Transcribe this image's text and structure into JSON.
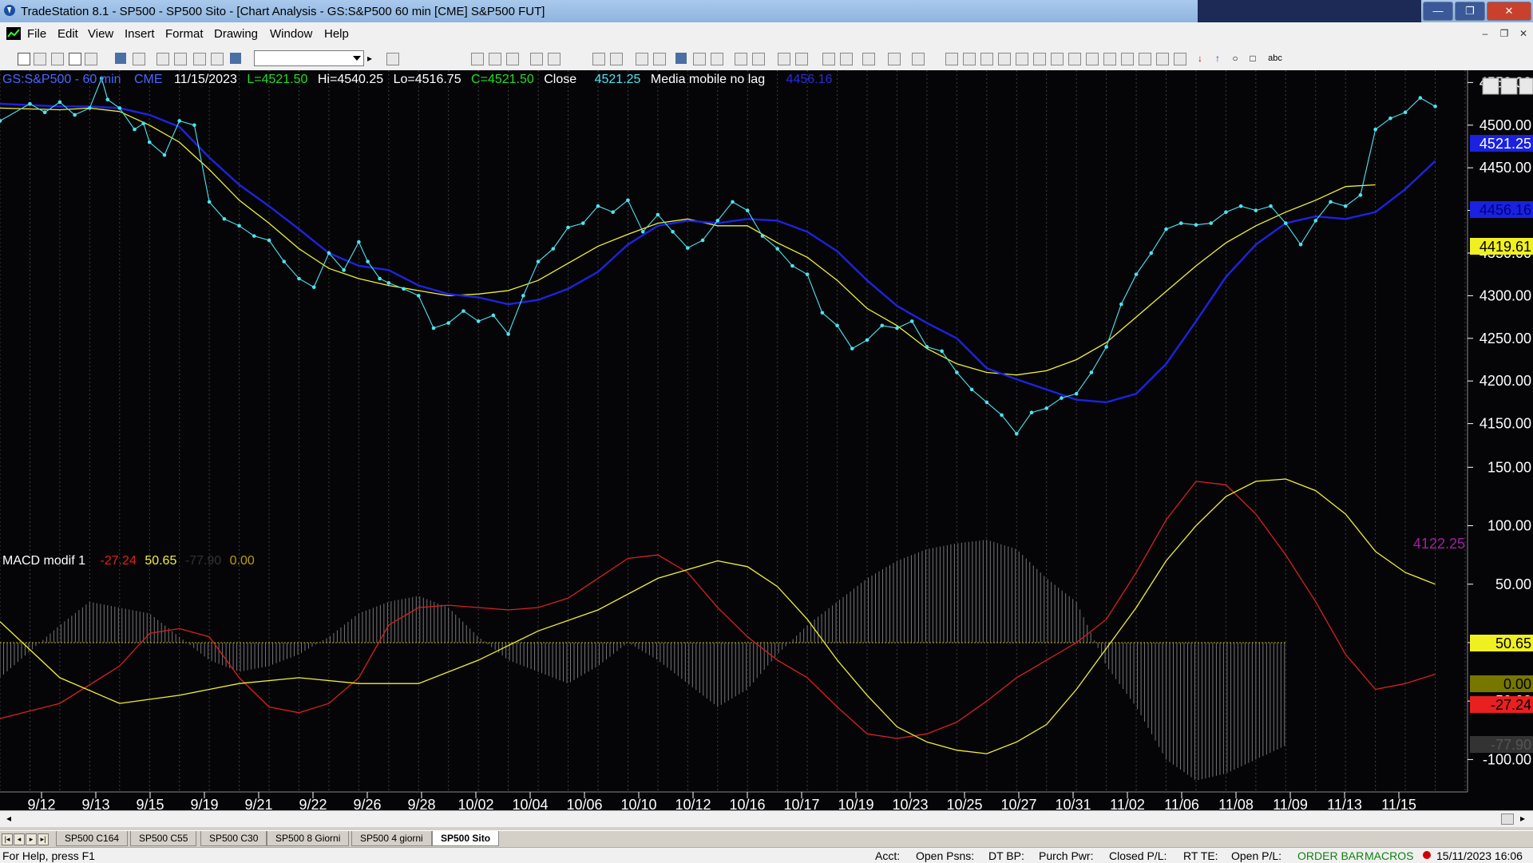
{
  "window": {
    "title": "TradeStation 8.1 - SP500 - SP500 Sito - [Chart Analysis - GS:S&P500  60 min  [CME] S&P500 FUT]",
    "controls": {
      "minimize": "—",
      "maximize": "❐",
      "close": "✕"
    }
  },
  "menu": {
    "items": [
      "File",
      "Edit",
      "View",
      "Insert",
      "Format",
      "Drawing",
      "Window",
      "Help"
    ]
  },
  "mdi_controls": {
    "minimize": "–",
    "restore": "❐",
    "close": "✕"
  },
  "chart_header": {
    "symbol": "GS:S&P500 - 60 min",
    "exchange": "CME",
    "date": "11/15/2023",
    "last": "L=4521.50",
    "high": "Hi=4540.25",
    "low": "Lo=4516.75",
    "close_val": "C=4521.50",
    "close_label": "Close",
    "close_value": "4521.25",
    "ma_label": "Media mobile no lag",
    "ma_value": "4456.16"
  },
  "macd_header": {
    "label": "MACD modif 1",
    "v1": "-27.24",
    "v2": "50.65",
    "v3": "-77.90",
    "v4": "0.00"
  },
  "colors": {
    "price": "#4fe4ef",
    "ma_blue": "#1e22e0",
    "ma_yellow": "#f0f032",
    "macd_red": "#d82020",
    "histogram": "#8a8a8a",
    "background": "#050508",
    "grid": "#555555",
    "axis_text": "#ffffff"
  },
  "chart_data": {
    "type": "line",
    "x_labels": [
      "9/12",
      "9/13",
      "9/15",
      "9/19",
      "9/21",
      "9/22",
      "9/26",
      "9/28",
      "10/02",
      "10/04",
      "10/06",
      "10/10",
      "10/12",
      "10/16",
      "10/17",
      "10/19",
      "10/23",
      "10/25",
      "10/27",
      "10/31",
      "11/02",
      "11/06",
      "11/08",
      "11/09",
      "11/13",
      "11/15"
    ],
    "price_panel": {
      "ylim": [
        4115,
        4555
      ],
      "y_ticks": [
        "4550.00",
        "4500.00",
        "4450.00",
        "4400.00",
        "4350.00",
        "4300.00",
        "4250.00",
        "4200.00",
        "4150.00"
      ],
      "price_anchors": [
        [
          0,
          4505
        ],
        [
          1,
          4525
        ],
        [
          1.5,
          4515
        ],
        [
          2,
          4527
        ],
        [
          2.5,
          4512
        ],
        [
          3,
          4520
        ],
        [
          3.4,
          4555
        ],
        [
          3.6,
          4530
        ],
        [
          4,
          4520
        ],
        [
          4.5,
          4495
        ],
        [
          4.8,
          4502
        ],
        [
          5,
          4480
        ],
        [
          5.5,
          4465
        ],
        [
          6,
          4505
        ],
        [
          6.5,
          4500
        ],
        [
          7,
          4410
        ],
        [
          7.5,
          4390
        ],
        [
          8,
          4382
        ],
        [
          8.5,
          4370
        ],
        [
          9,
          4365
        ],
        [
          9.5,
          4340
        ],
        [
          10,
          4320
        ],
        [
          10.5,
          4310
        ],
        [
          11,
          4350
        ],
        [
          11.5,
          4330
        ],
        [
          12,
          4363
        ],
        [
          12.3,
          4340
        ],
        [
          12.7,
          4320
        ],
        [
          13,
          4315
        ],
        [
          13.5,
          4308
        ],
        [
          14,
          4300
        ],
        [
          14.5,
          4262
        ],
        [
          15,
          4268
        ],
        [
          15.5,
          4282
        ],
        [
          16,
          4270
        ],
        [
          16.5,
          4277
        ],
        [
          17,
          4255
        ],
        [
          17.5,
          4300
        ],
        [
          18,
          4340
        ],
        [
          18.5,
          4355
        ],
        [
          19,
          4380
        ],
        [
          19.5,
          4385
        ],
        [
          20,
          4405
        ],
        [
          20.5,
          4398
        ],
        [
          21,
          4412
        ],
        [
          21.5,
          4375
        ],
        [
          22,
          4395
        ],
        [
          22.5,
          4375
        ],
        [
          23,
          4356
        ],
        [
          23.5,
          4365
        ],
        [
          24,
          4388
        ],
        [
          24.5,
          4410
        ],
        [
          25,
          4400
        ],
        [
          25.5,
          4370
        ],
        [
          26,
          4355
        ],
        [
          26.5,
          4335
        ],
        [
          27,
          4325
        ],
        [
          27.5,
          4280
        ],
        [
          28,
          4265
        ],
        [
          28.5,
          4238
        ],
        [
          29,
          4248
        ],
        [
          29.5,
          4265
        ],
        [
          30,
          4262
        ],
        [
          30.5,
          4270
        ],
        [
          31,
          4240
        ],
        [
          31.5,
          4235
        ],
        [
          32,
          4210
        ],
        [
          32.5,
          4190
        ],
        [
          33,
          4175
        ],
        [
          33.5,
          4160
        ],
        [
          34,
          4138
        ],
        [
          34.5,
          4163
        ],
        [
          35,
          4168
        ],
        [
          35.5,
          4180
        ],
        [
          36,
          4185
        ],
        [
          36.5,
          4210
        ],
        [
          37,
          4240
        ],
        [
          37.5,
          4290
        ],
        [
          38,
          4325
        ],
        [
          38.5,
          4350
        ],
        [
          39,
          4378
        ],
        [
          39.5,
          4385
        ],
        [
          40,
          4383
        ],
        [
          40.5,
          4385
        ],
        [
          41,
          4398
        ],
        [
          41.5,
          4405
        ],
        [
          42,
          4400
        ],
        [
          42.5,
          4405
        ],
        [
          43,
          4385
        ],
        [
          43.5,
          4360
        ],
        [
          44,
          4388
        ],
        [
          44.5,
          4410
        ],
        [
          45,
          4405
        ],
        [
          45.5,
          4418
        ],
        [
          46,
          4495
        ],
        [
          46.5,
          4508
        ],
        [
          47,
          4515
        ],
        [
          47.5,
          4532
        ],
        [
          48,
          4522
        ]
      ],
      "ma_blue_anchors": [
        [
          0,
          4525
        ],
        [
          2,
          4522
        ],
        [
          3,
          4522
        ],
        [
          4,
          4520
        ],
        [
          5,
          4512
        ],
        [
          6,
          4498
        ],
        [
          7,
          4462
        ],
        [
          8,
          4430
        ],
        [
          9,
          4405
        ],
        [
          10,
          4378
        ],
        [
          11,
          4350
        ],
        [
          12,
          4335
        ],
        [
          13,
          4330
        ],
        [
          14,
          4312
        ],
        [
          15,
          4302
        ],
        [
          16,
          4298
        ],
        [
          17,
          4290
        ],
        [
          18,
          4295
        ],
        [
          19,
          4308
        ],
        [
          20,
          4328
        ],
        [
          21,
          4360
        ],
        [
          22,
          4382
        ],
        [
          23,
          4388
        ],
        [
          24,
          4385
        ],
        [
          25,
          4390
        ],
        [
          26,
          4388
        ],
        [
          27,
          4375
        ],
        [
          28,
          4352
        ],
        [
          29,
          4318
        ],
        [
          30,
          4288
        ],
        [
          31,
          4268
        ],
        [
          32,
          4250
        ],
        [
          33,
          4215
        ],
        [
          34,
          4202
        ],
        [
          35,
          4190
        ],
        [
          36,
          4178
        ],
        [
          37,
          4175
        ],
        [
          38,
          4185
        ],
        [
          39,
          4220
        ],
        [
          40,
          4270
        ],
        [
          41,
          4322
        ],
        [
          42,
          4360
        ],
        [
          43,
          4385
        ],
        [
          44,
          4393
        ],
        [
          45,
          4390
        ],
        [
          46,
          4398
        ],
        [
          47,
          4425
        ],
        [
          48,
          4458
        ]
      ],
      "ma_yellow_anchors": [
        [
          0,
          4520
        ],
        [
          2,
          4518
        ],
        [
          3,
          4520
        ],
        [
          4,
          4516
        ],
        [
          5,
          4500
        ],
        [
          6,
          4480
        ],
        [
          7,
          4448
        ],
        [
          8,
          4412
        ],
        [
          9,
          4385
        ],
        [
          10,
          4355
        ],
        [
          11,
          4332
        ],
        [
          12,
          4320
        ],
        [
          13,
          4312
        ],
        [
          14,
          4306
        ],
        [
          15,
          4300
        ],
        [
          16,
          4302
        ],
        [
          17,
          4306
        ],
        [
          18,
          4318
        ],
        [
          19,
          4338
        ],
        [
          20,
          4358
        ],
        [
          21,
          4372
        ],
        [
          22,
          4385
        ],
        [
          23,
          4390
        ],
        [
          24,
          4382
        ],
        [
          25,
          4382
        ],
        [
          26,
          4362
        ],
        [
          27,
          4345
        ],
        [
          28,
          4318
        ],
        [
          29,
          4285
        ],
        [
          30,
          4265
        ],
        [
          31,
          4238
        ],
        [
          32,
          4220
        ],
        [
          33,
          4210
        ],
        [
          34,
          4207
        ],
        [
          35,
          4212
        ],
        [
          36,
          4225
        ],
        [
          37,
          4245
        ],
        [
          38,
          4275
        ],
        [
          39,
          4305
        ],
        [
          40,
          4335
        ],
        [
          41,
          4362
        ],
        [
          42,
          4382
        ],
        [
          43,
          4398
        ],
        [
          44,
          4412
        ],
        [
          45,
          4428
        ],
        [
          46,
          4430
        ]
      ]
    },
    "macd_panel": {
      "ylim": [
        -125,
        155
      ],
      "y_ticks": [
        "150.00",
        "100.00",
        "50.00",
        "0.00",
        "-50.00",
        "-100.00"
      ],
      "red_anchors": [
        [
          0,
          -65
        ],
        [
          2,
          -52
        ],
        [
          4,
          -20
        ],
        [
          5,
          8
        ],
        [
          6,
          12
        ],
        [
          7,
          5
        ],
        [
          8,
          -30
        ],
        [
          9,
          -55
        ],
        [
          10,
          -60
        ],
        [
          11,
          -52
        ],
        [
          12,
          -30
        ],
        [
          13,
          15
        ],
        [
          14,
          30
        ],
        [
          15,
          32
        ],
        [
          16,
          30
        ],
        [
          17,
          28
        ],
        [
          18,
          30
        ],
        [
          19,
          38
        ],
        [
          20,
          55
        ],
        [
          21,
          72
        ],
        [
          22,
          75
        ],
        [
          23,
          60
        ],
        [
          24,
          30
        ],
        [
          25,
          5
        ],
        [
          26,
          -15
        ],
        [
          27,
          -30
        ],
        [
          28,
          -55
        ],
        [
          29,
          -78
        ],
        [
          30,
          -82
        ],
        [
          31,
          -78
        ],
        [
          32,
          -68
        ],
        [
          33,
          -50
        ],
        [
          34,
          -30
        ],
        [
          35,
          -15
        ],
        [
          36,
          0
        ],
        [
          37,
          20
        ],
        [
          38,
          60
        ],
        [
          39,
          105
        ],
        [
          40,
          138
        ],
        [
          41,
          135
        ],
        [
          42,
          110
        ],
        [
          43,
          75
        ],
        [
          44,
          35
        ],
        [
          45,
          -10
        ],
        [
          46,
          -40
        ],
        [
          47,
          -35
        ],
        [
          48,
          -27
        ]
      ],
      "yellow_anchors": [
        [
          0,
          18
        ],
        [
          2,
          -30
        ],
        [
          4,
          -52
        ],
        [
          6,
          -45
        ],
        [
          8,
          -35
        ],
        [
          10,
          -30
        ],
        [
          12,
          -35
        ],
        [
          14,
          -35
        ],
        [
          16,
          -15
        ],
        [
          18,
          10
        ],
        [
          20,
          28
        ],
        [
          22,
          55
        ],
        [
          24,
          70
        ],
        [
          25,
          65
        ],
        [
          26,
          48
        ],
        [
          27,
          20
        ],
        [
          28,
          -15
        ],
        [
          29,
          -45
        ],
        [
          30,
          -72
        ],
        [
          31,
          -85
        ],
        [
          32,
          -92
        ],
        [
          33,
          -95
        ],
        [
          34,
          -85
        ],
        [
          35,
          -70
        ],
        [
          36,
          -40
        ],
        [
          37,
          -5
        ],
        [
          38,
          30
        ],
        [
          39,
          70
        ],
        [
          40,
          100
        ],
        [
          41,
          125
        ],
        [
          42,
          138
        ],
        [
          43,
          140
        ],
        [
          44,
          130
        ],
        [
          45,
          110
        ],
        [
          46,
          78
        ],
        [
          47,
          60
        ],
        [
          48,
          50
        ]
      ],
      "histogram_anchors": [
        [
          0,
          -30
        ],
        [
          2,
          15
        ],
        [
          3,
          35
        ],
        [
          4,
          30
        ],
        [
          5,
          25
        ],
        [
          6,
          5
        ],
        [
          7,
          -15
        ],
        [
          8,
          -25
        ],
        [
          9,
          -20
        ],
        [
          10,
          -10
        ],
        [
          11,
          5
        ],
        [
          12,
          25
        ],
        [
          13,
          35
        ],
        [
          14,
          40
        ],
        [
          15,
          30
        ],
        [
          16,
          5
        ],
        [
          17,
          -15
        ],
        [
          18,
          -25
        ],
        [
          19,
          -35
        ],
        [
          20,
          -20
        ],
        [
          21,
          0
        ],
        [
          22,
          -15
        ],
        [
          23,
          -35
        ],
        [
          24,
          -55
        ],
        [
          25,
          -40
        ],
        [
          26,
          -10
        ],
        [
          27,
          15
        ],
        [
          28,
          35
        ],
        [
          29,
          55
        ],
        [
          30,
          70
        ],
        [
          31,
          80
        ],
        [
          32,
          85
        ],
        [
          33,
          88
        ],
        [
          34,
          80
        ],
        [
          35,
          55
        ],
        [
          36,
          35
        ],
        [
          37,
          -20
        ],
        [
          38,
          -55
        ],
        [
          39,
          -100
        ],
        [
          40,
          -118
        ],
        [
          41,
          -112
        ],
        [
          42,
          -100
        ],
        [
          43,
          -88
        ]
      ]
    },
    "floating_value": "4122.25",
    "axis_labels": {
      "price_blue": "4456.16",
      "price_yellow": "4419.61",
      "price_close": "4521.25",
      "macd_yellow": "50.65",
      "macd_zero": "0.00",
      "macd_red": "-27.24",
      "macd_gray": "-77.90"
    }
  },
  "tabs": [
    "SP500 C164",
    "SP500 C55",
    "SP500 C30",
    "SP500 8 Giorni",
    "SP500 4 giorni",
    "SP500 Sito"
  ],
  "status": {
    "help": "For Help, press F1",
    "acct": "Acct:",
    "open_psns": "Open Psns:",
    "dt_bp": "DT BP:",
    "purch_pwr": "Purch Pwr:",
    "closed_pl": "Closed P/L:",
    "rt_te": "RT TE:",
    "open_pl": "Open P/L:",
    "order_bar": "ORDER BAR",
    "macros": "MACROS",
    "datetime": "15/11/2023 16:06"
  }
}
